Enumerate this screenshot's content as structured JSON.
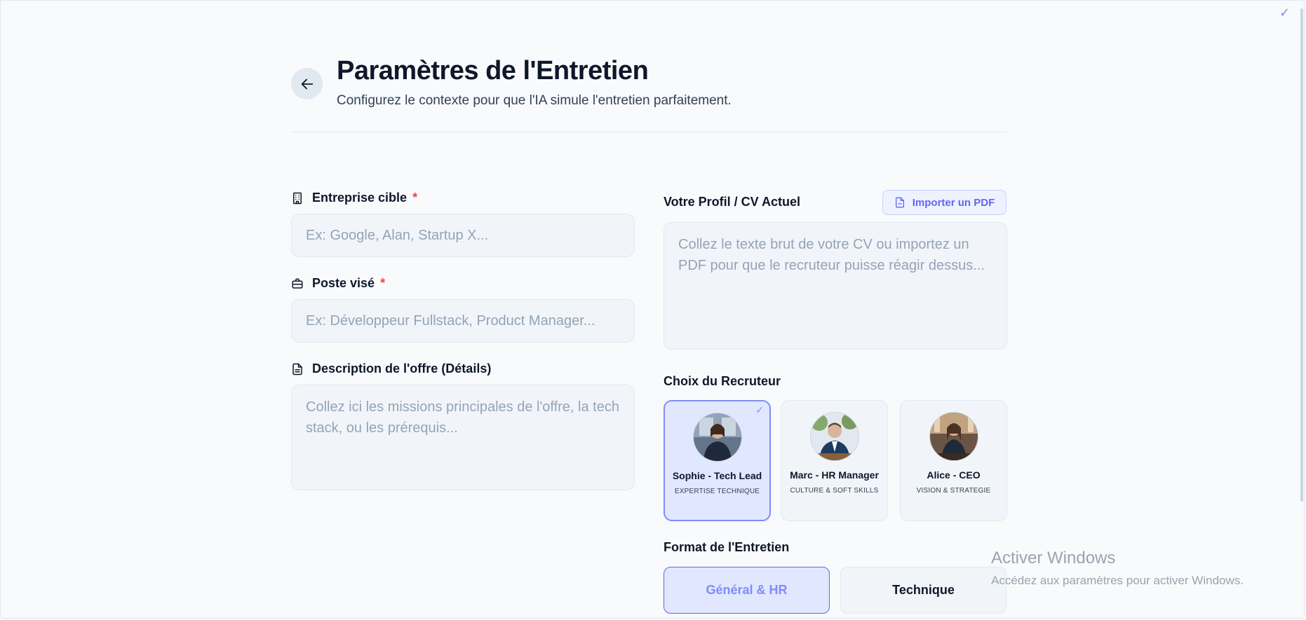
{
  "header": {
    "title": "Paramètres de l'Entretien",
    "subtitle": "Configurez le contexte pour que l'IA simule l'entretien parfaitement."
  },
  "form": {
    "company": {
      "label": "Entreprise cible",
      "required_mark": "*",
      "placeholder": "Ex: Google, Alan, Startup X...",
      "value": ""
    },
    "position": {
      "label": "Poste visé",
      "required_mark": "*",
      "placeholder": "Ex: Développeur Fullstack, Product Manager...",
      "value": ""
    },
    "description": {
      "label": "Description de l'offre (Détails)",
      "placeholder": "Collez ici les missions principales de l'offre, la tech stack, ou les prérequis...",
      "value": ""
    }
  },
  "profile": {
    "label": "Votre Profil / CV Actuel",
    "import_label": "Importer un PDF",
    "placeholder": "Collez le texte brut de votre CV ou importez un PDF pour que le recruteur puisse réagir dessus...",
    "value": ""
  },
  "recruiters": {
    "label": "Choix du Recruteur",
    "selected": "Sophie - Tech Lead",
    "items": [
      {
        "name": "Sophie - Tech Lead",
        "tag": "EXPERTISE TECHNIQUE",
        "selected": true
      },
      {
        "name": "Marc - HR Manager",
        "tag": "CULTURE & SOFT SKILLS",
        "selected": false
      },
      {
        "name": "Alice - CEO",
        "tag": "VISION & STRATEGIE",
        "selected": false
      }
    ]
  },
  "format": {
    "label": "Format de l'Entretien",
    "options": [
      {
        "label": "Général & HR",
        "active": true
      },
      {
        "label": "Technique",
        "active": false
      }
    ]
  },
  "watermark": {
    "line1": "Activer Windows",
    "line2": "Accédez aux paramètres pour activer Windows."
  },
  "colors": {
    "accent": "#6366f1",
    "accent_light": "#e0e7ff",
    "required": "#ef4444",
    "field_bg": "#f1f5f9",
    "page_bg": "#f8fafc"
  }
}
